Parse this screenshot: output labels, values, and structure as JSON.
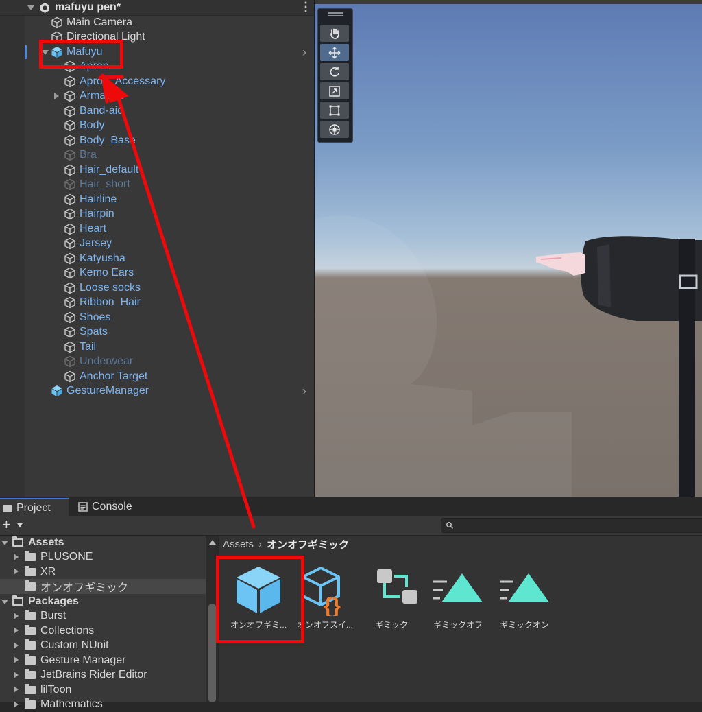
{
  "hierarchy": {
    "scene_name": "mafuyu pen*",
    "items": [
      {
        "label": "Main Camera",
        "style": "white"
      },
      {
        "label": "Directional Light",
        "style": "white"
      },
      {
        "label": "Mafuyu",
        "style": "blue"
      },
      {
        "label": "Apron",
        "style": "blue"
      },
      {
        "label": "Apron_Accessary",
        "style": "blue"
      },
      {
        "label": "Armature",
        "style": "blue"
      },
      {
        "label": "Band-aid",
        "style": "blue"
      },
      {
        "label": "Body",
        "style": "blue"
      },
      {
        "label": "Body_Base",
        "style": "blue"
      },
      {
        "label": "Bra",
        "style": "dim"
      },
      {
        "label": "Hair_default",
        "style": "blue"
      },
      {
        "label": "Hair_short",
        "style": "dim"
      },
      {
        "label": "Hairline",
        "style": "blue"
      },
      {
        "label": "Hairpin",
        "style": "blue"
      },
      {
        "label": "Heart",
        "style": "blue"
      },
      {
        "label": "Jersey",
        "style": "blue"
      },
      {
        "label": "Katyusha",
        "style": "blue"
      },
      {
        "label": "Kemo Ears",
        "style": "blue"
      },
      {
        "label": "Loose socks",
        "style": "blue"
      },
      {
        "label": "Ribbon_Hair",
        "style": "blue"
      },
      {
        "label": "Shoes",
        "style": "blue"
      },
      {
        "label": "Spats",
        "style": "blue"
      },
      {
        "label": "Tail",
        "style": "blue"
      },
      {
        "label": "Underwear",
        "style": "dim"
      },
      {
        "label": "Anchor Target",
        "style": "blue"
      },
      {
        "label": "GestureManager",
        "style": "blue"
      }
    ]
  },
  "tabs": {
    "project": "Project",
    "console": "Console"
  },
  "project": {
    "tree": [
      {
        "label": "Assets",
        "bold": true
      },
      {
        "label": "PLUSONE"
      },
      {
        "label": "XR"
      },
      {
        "label": "オンオフギミック"
      },
      {
        "label": "Packages",
        "bold": true
      },
      {
        "label": "Burst"
      },
      {
        "label": "Collections"
      },
      {
        "label": "Custom NUnit"
      },
      {
        "label": "Gesture Manager"
      },
      {
        "label": "JetBrains Rider Editor"
      },
      {
        "label": "lilToon"
      },
      {
        "label": "Mathematics"
      }
    ],
    "breadcrumb": {
      "root": "Assets",
      "separator": "›",
      "current": "オンオフギミック"
    },
    "assets": [
      {
        "label": "オンオフギミ...",
        "icon": "prefab-cube-icon"
      },
      {
        "label": "オンオフスイ...",
        "icon": "script-cube-icon"
      },
      {
        "label": "ギミック",
        "icon": "animator-controller-icon"
      },
      {
        "label": "ギミックオフ",
        "icon": "animation-clip-icon"
      },
      {
        "label": "ギミックオン",
        "icon": "animation-clip-icon"
      }
    ]
  },
  "colors": {
    "annotation_red": "#ee0a0a",
    "prefab_blue": "#6cc4f4",
    "clip_teal": "#5ee6d0",
    "script_orange": "#f07a2a"
  }
}
